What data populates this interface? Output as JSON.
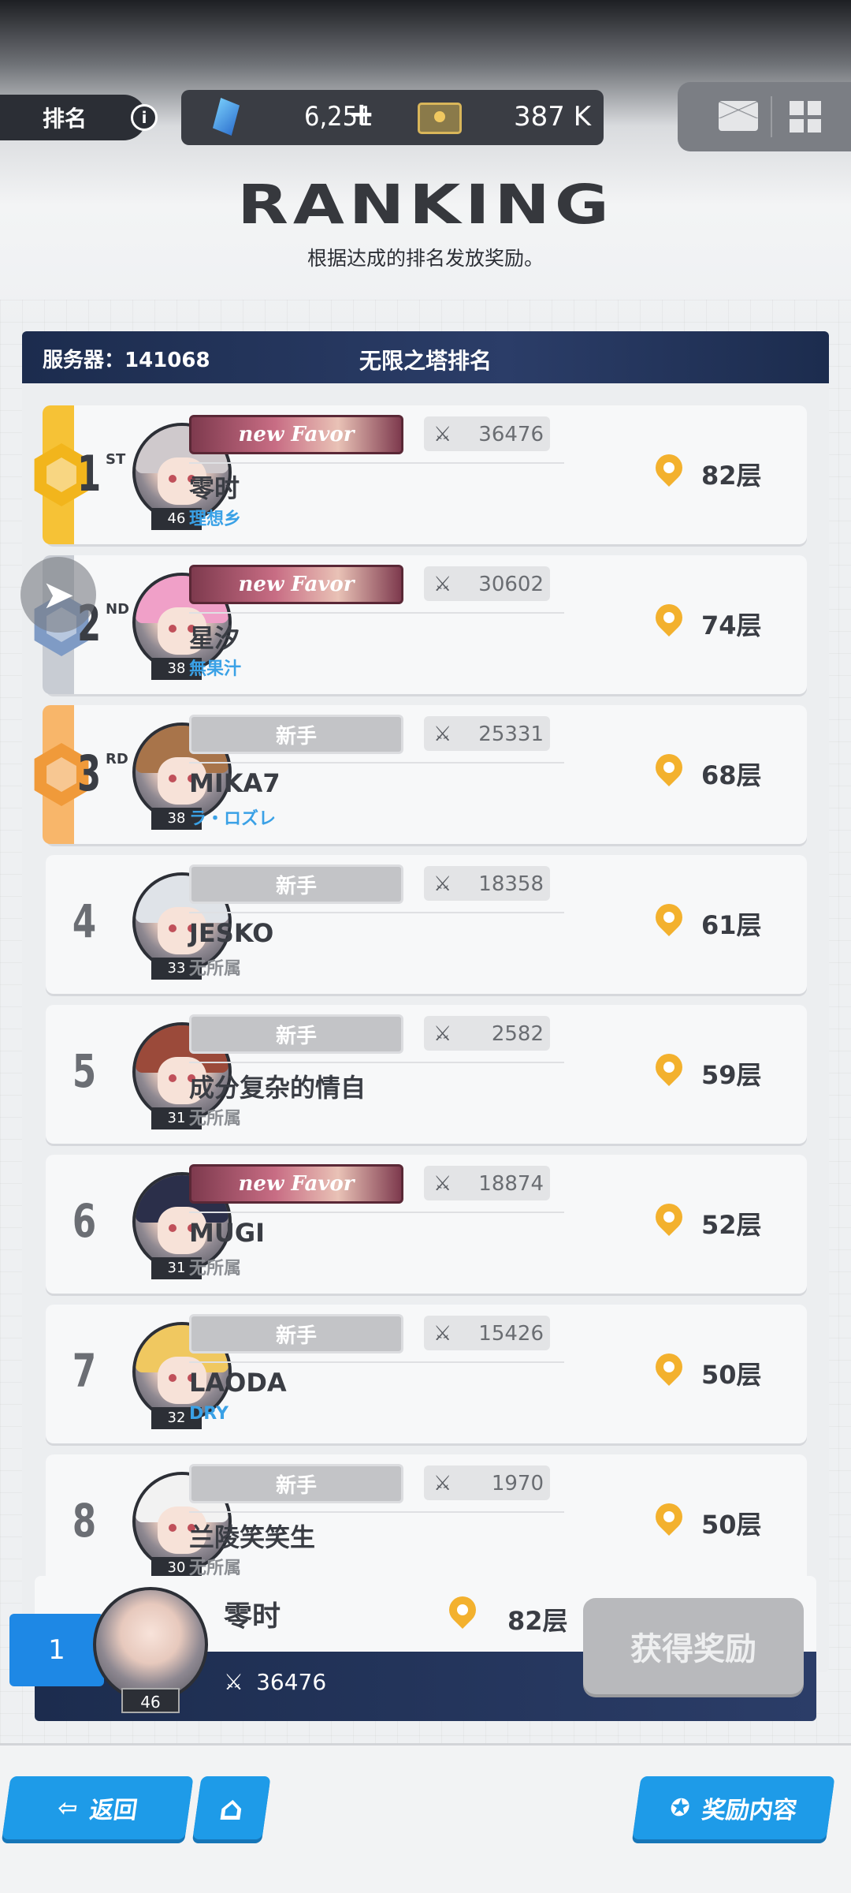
{
  "topbar": {
    "rank_label": "排名",
    "info_icon": "info-icon",
    "gems": "6,251",
    "gems_plus": "+",
    "coins": "387 K",
    "mail_icon": "mail-icon",
    "menu_icon": "grid-menu-icon"
  },
  "header": {
    "title": "RANKING",
    "subtitle": "根据达成的排名发放奖励。"
  },
  "panel": {
    "server": "服务器：141068",
    "tower_title": "无限之塔排名"
  },
  "players": [
    {
      "rank": "1",
      "suffix": "ST",
      "title": "new Favor",
      "title_type": "favor",
      "power": "36476",
      "name": "零时",
      "guild": "理想乡",
      "guild_color": "#3aa1e6",
      "level": "46",
      "floor": "82层",
      "stripe": "#f6c236",
      "medal": "#f2b51c"
    },
    {
      "rank": "2",
      "suffix": "ND",
      "title": "new Favor",
      "title_type": "favor",
      "power": "30602",
      "name": "星汐",
      "guild": "無果汁",
      "guild_color": "#3aa1e6",
      "level": "38",
      "floor": "74层",
      "stripe": "#c8ccd3",
      "medal": "#7f9bc5"
    },
    {
      "rank": "3",
      "suffix": "RD",
      "title": "新手",
      "title_type": "newbie",
      "power": "25331",
      "name": "MIKA7",
      "guild": "ラ・ロズレ",
      "guild_color": "#3aa1e6",
      "level": "38",
      "floor": "68层",
      "stripe": "#f8b66a",
      "medal": "#f09a3a"
    },
    {
      "rank": "4",
      "suffix": "",
      "title": "新手",
      "title_type": "newbie",
      "power": "18358",
      "name": "JESKO",
      "guild": "无所属",
      "guild_color": "#8a8d92",
      "level": "33",
      "floor": "61层"
    },
    {
      "rank": "5",
      "suffix": "",
      "title": "新手",
      "title_type": "newbie",
      "power": "2582",
      "name": "成分复杂的情自",
      "guild": "无所属",
      "guild_color": "#8a8d92",
      "level": "31",
      "floor": "59层"
    },
    {
      "rank": "6",
      "suffix": "",
      "title": "new Favor",
      "title_type": "favor",
      "power": "18874",
      "name": "MUGI",
      "guild": "无所属",
      "guild_color": "#8a8d92",
      "level": "31",
      "floor": "52层"
    },
    {
      "rank": "7",
      "suffix": "",
      "title": "新手",
      "title_type": "newbie",
      "power": "15426",
      "name": "LAODA",
      "guild": "DRY",
      "guild_color": "#3aa1e6",
      "level": "32",
      "floor": "50层"
    },
    {
      "rank": "8",
      "suffix": "",
      "title": "新手",
      "title_type": "newbie",
      "power": "1970",
      "name": "兰陵笑笑生",
      "guild": "无所属",
      "guild_color": "#8a8d92",
      "level": "30",
      "floor": "50层"
    }
  ],
  "mine": {
    "rank": "1",
    "name": "零时",
    "floor": "82层",
    "power": "36476",
    "level": "46",
    "claim_label": "获得奖励"
  },
  "bottom": {
    "back_label": "返回",
    "reward_label": "奖励内容"
  }
}
